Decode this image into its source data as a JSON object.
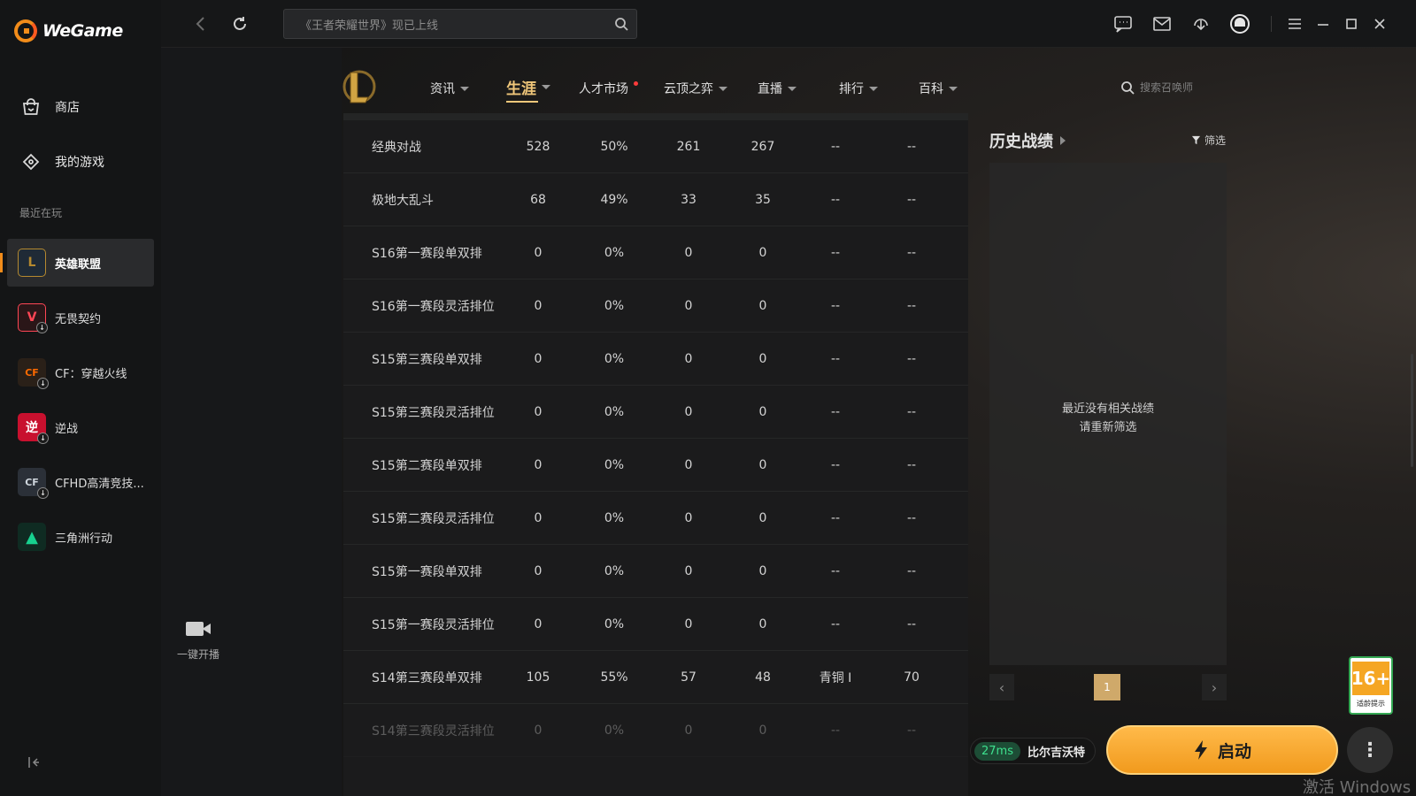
{
  "app": {
    "name": "WeGame"
  },
  "topbar": {
    "search_placeholder": "《王者荣耀世界》现已上线"
  },
  "sidebar": {
    "nav": [
      {
        "label": "商店"
      },
      {
        "label": "我的游戏"
      }
    ],
    "recent_label": "最近在玩",
    "games": [
      {
        "label": "英雄联盟",
        "icon": "L",
        "color": "#b5892f",
        "bg": "#1f2a36",
        "download": false
      },
      {
        "label": "无畏契约",
        "icon": "V",
        "color": "#ff4655",
        "bg": "#2a1618",
        "download": true
      },
      {
        "label": "CF：穿越火线",
        "icon": "CF",
        "color": "#ff6a00",
        "bg": "#2a2018",
        "download": true
      },
      {
        "label": "逆战",
        "icon": "逆",
        "color": "#ffffff",
        "bg": "#c8102e",
        "download": true
      },
      {
        "label": "CFHD高清竞技...",
        "icon": "CF",
        "color": "#cfd6dd",
        "bg": "#2b3038",
        "download": true
      },
      {
        "label": "三角洲行动",
        "icon": "▲",
        "color": "#17d18f",
        "bg": "#0f2b22",
        "download": false
      }
    ]
  },
  "game_nav": {
    "tabs": [
      {
        "label": "资讯",
        "caret": true
      },
      {
        "label": "生涯",
        "caret": true,
        "active": true
      },
      {
        "label": "人才市场",
        "dot": true
      },
      {
        "label": "云顶之弈",
        "caret": true
      },
      {
        "label": "直播",
        "caret": true
      },
      {
        "label": "排行",
        "caret": true
      },
      {
        "label": "百科",
        "caret": true
      }
    ],
    "search_placeholder": "搜索召唤师"
  },
  "stats": {
    "rows": [
      {
        "mode": "经典对战",
        "games": "528",
        "winrate": "50%",
        "wins": "261",
        "losses": "267",
        "rank": "--",
        "points": "--"
      },
      {
        "mode": "极地大乱斗",
        "games": "68",
        "winrate": "49%",
        "wins": "33",
        "losses": "35",
        "rank": "--",
        "points": "--"
      },
      {
        "mode": "S16第一赛段单双排",
        "games": "0",
        "winrate": "0%",
        "wins": "0",
        "losses": "0",
        "rank": "--",
        "points": "--"
      },
      {
        "mode": "S16第一赛段灵活排位",
        "games": "0",
        "winrate": "0%",
        "wins": "0",
        "losses": "0",
        "rank": "--",
        "points": "--"
      },
      {
        "mode": "S15第三赛段单双排",
        "games": "0",
        "winrate": "0%",
        "wins": "0",
        "losses": "0",
        "rank": "--",
        "points": "--"
      },
      {
        "mode": "S15第三赛段灵活排位",
        "games": "0",
        "winrate": "0%",
        "wins": "0",
        "losses": "0",
        "rank": "--",
        "points": "--"
      },
      {
        "mode": "S15第二赛段单双排",
        "games": "0",
        "winrate": "0%",
        "wins": "0",
        "losses": "0",
        "rank": "--",
        "points": "--"
      },
      {
        "mode": "S15第二赛段灵活排位",
        "games": "0",
        "winrate": "0%",
        "wins": "0",
        "losses": "0",
        "rank": "--",
        "points": "--"
      },
      {
        "mode": "S15第一赛段单双排",
        "games": "0",
        "winrate": "0%",
        "wins": "0",
        "losses": "0",
        "rank": "--",
        "points": "--"
      },
      {
        "mode": "S15第一赛段灵活排位",
        "games": "0",
        "winrate": "0%",
        "wins": "0",
        "losses": "0",
        "rank": "--",
        "points": "--"
      },
      {
        "mode": "S14第三赛段单双排",
        "games": "105",
        "winrate": "55%",
        "wins": "57",
        "losses": "48",
        "rank": "青铜 I",
        "points": "70"
      },
      {
        "mode": "S14第三赛段灵活排位",
        "games": "0",
        "winrate": "0%",
        "wins": "0",
        "losses": "0",
        "rank": "--",
        "points": "--"
      }
    ]
  },
  "history": {
    "title": "历史战绩",
    "filter_label": "筛选",
    "empty_line1": "最近没有相关战绩",
    "empty_line2": "请重新筛选",
    "current_page": "1"
  },
  "live": {
    "label": "一键开播"
  },
  "bottom": {
    "ping": "27ms",
    "server": "比尔吉沃特",
    "launch_label": "启动",
    "more_label": "⋮",
    "age_rating": "16+",
    "age_text": "适龄提示",
    "watermark": "激活 Windows"
  },
  "colors": {
    "accent": "#f28c1a",
    "tab_active": "#f0c77a",
    "launch": "#f5a623",
    "ping_green": "#3ee08e"
  }
}
